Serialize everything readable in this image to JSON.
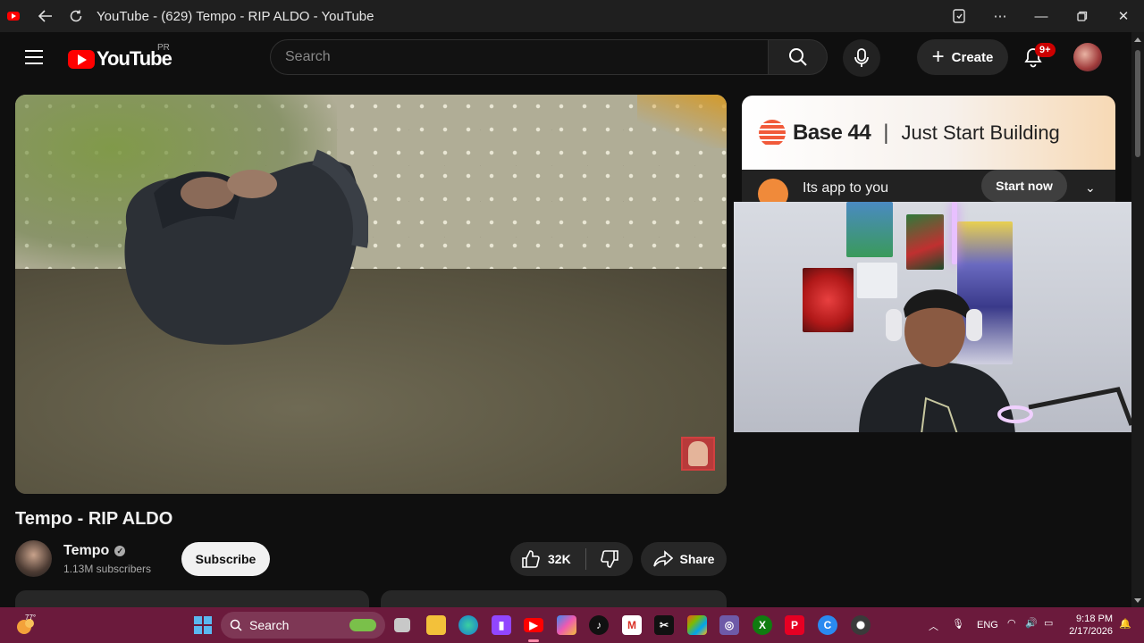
{
  "window": {
    "title": "YouTube - (629) Tempo - RIP ALDO - YouTube",
    "back_icon": "arrow-left-icon",
    "reload_icon": "reload-icon"
  },
  "header": {
    "logo_text": "YouTube",
    "region": "PR",
    "search_placeholder": "Search",
    "create_label": "Create",
    "notifications_badge": "9+"
  },
  "ad": {
    "brand": "Base 44",
    "separator": "|",
    "tagline": "Just Start Building",
    "headline": "Its app to you",
    "cta": "Start now"
  },
  "video": {
    "title": "Tempo - RIP ALDO",
    "channel": "Tempo",
    "subscribers": "1.13M subscribers",
    "subscribe_label": "Subscribe",
    "likes": "32K",
    "share_label": "Share"
  },
  "taskbar": {
    "weather_temp": "77°",
    "search_label": "Search",
    "language": "ENG",
    "time": "9:18 PM",
    "date": "2/17/2026"
  },
  "colors": {
    "youtube_red": "#ff0000",
    "taskbar": "#6b1a3c",
    "background": "#0f0f0f"
  }
}
